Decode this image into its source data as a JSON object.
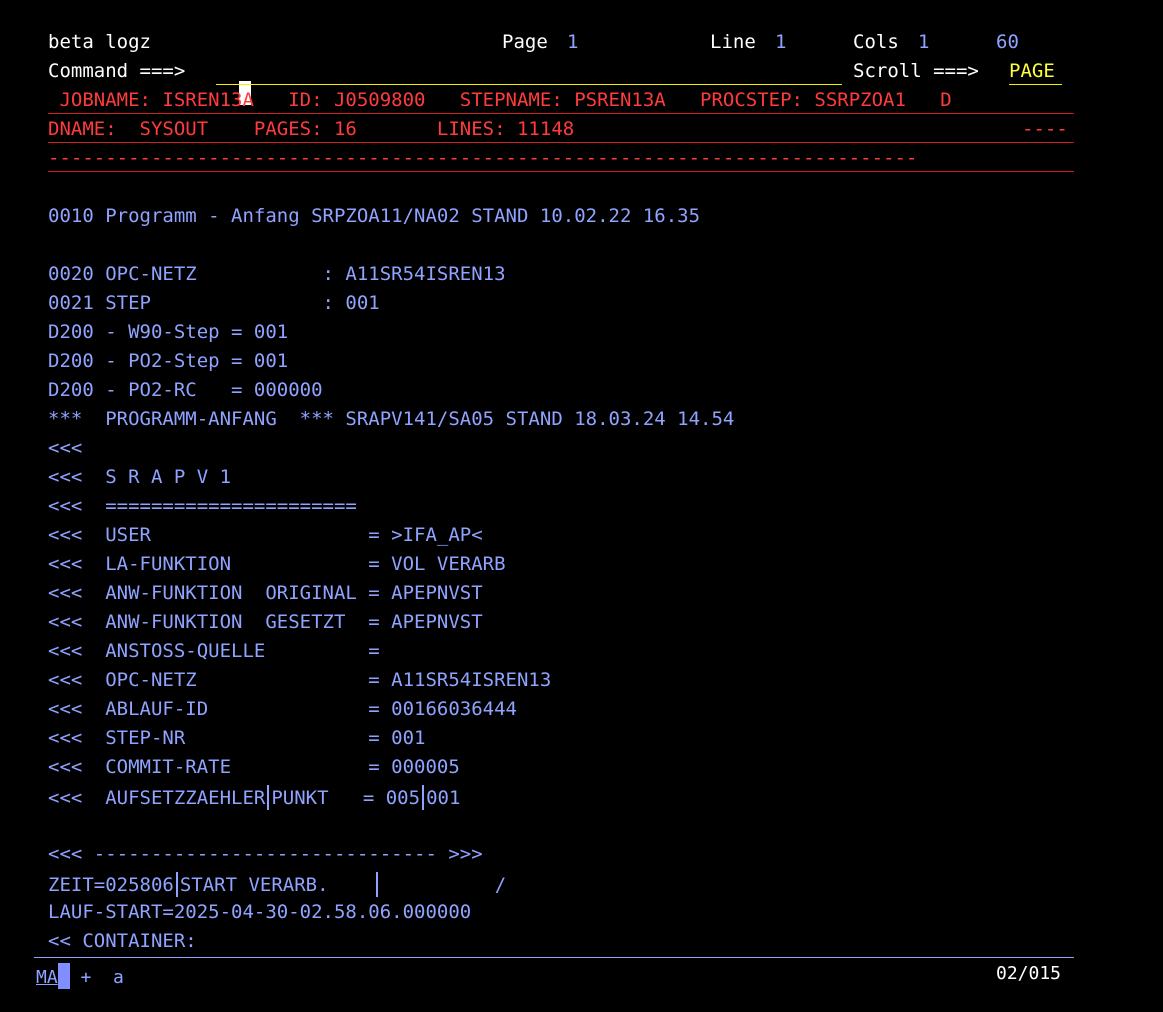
{
  "header": {
    "title": "beta logz",
    "page_label": "Page",
    "page_value": "1",
    "line_label": "Line",
    "line_value": "1",
    "cols_label": "Cols",
    "cols_from": "1",
    "cols_to": "60",
    "command_label": "Command ===>",
    "command_value": "",
    "scroll_label": "Scroll ===>",
    "scroll_value": "PAGE"
  },
  "job_info": {
    "line1": " JOBNAME: ISREN13A   ID: J0509800   STEPNAME: PSREN13A   PROCSTEP: SSRPZOA1   D",
    "line2_left": "DNAME:  SYSOUT    PAGES: 16       LINES: 11148",
    "line2_right": "----",
    "line3": "----------------------------------------------------------------------------"
  },
  "content": {
    "l0010": "0010 Programm - Anfang SRPZOA11/NA02 STAND 10.02.22 16.35",
    "l0020": "0020 OPC-NETZ           : A11SR54ISREN13",
    "l0021": "0021 STEP               : 001",
    "d200a": "D200 - W90-Step = 001",
    "d200b": "D200 - PO2-Step = 001",
    "d200c": "D200 - PO2-RC   = 000000",
    "prog_anfang": "***  PROGRAMM-ANFANG  *** SRAPV141/SA05 STAND 18.03.24 14.54",
    "lt1": "<<<",
    "srapv": "<<<  S R A P V 1",
    "equals": "<<<  ======================",
    "user": "<<<  USER                   = >IFA_AP<",
    "la_funktion": "<<<  LA-FUNKTION            = VOL VERARB",
    "anw_orig": "<<<  ANW-FUNKTION  ORIGINAL = APEPNVST",
    "anw_ges": "<<<  ANW-FUNKTION  GESETZT  = APEPNVST",
    "anstoss": "<<<  ANSTOSS-QUELLE         =",
    "opc": "<<<  OPC-NETZ               = A11SR54ISREN13",
    "ablauf": "<<<  ABLAUF-ID              = 00166036444",
    "step_nr": "<<<  STEP-NR                = 001",
    "commit": "<<<  COMMIT-RATE            = 000005",
    "aufsetz_a": "<<<  AUFSETZZAEHLER",
    "aufsetz_b": "PUNKT   = 005",
    "aufsetz_c": "001",
    "separator": "<<< ------------------------------ >>>",
    "zeit_a": "ZEIT=025806",
    "zeit_b": "START VERARB.    ",
    "zeit_c": "          /",
    "lauf_start": "LAUF-START=2025-04-30-02.58.06.000000",
    "container": "<< CONTAINER:"
  },
  "status_bar": {
    "mode_a": "M",
    "mode_b": "A",
    "indicator": " +  a",
    "position": "02/015"
  },
  "colors": {
    "background": "#000000",
    "text_blue": "#8fa3ff",
    "text_red": "#ff3b3b",
    "text_white": "#ffffff",
    "text_yellow": "#ffff3a"
  }
}
